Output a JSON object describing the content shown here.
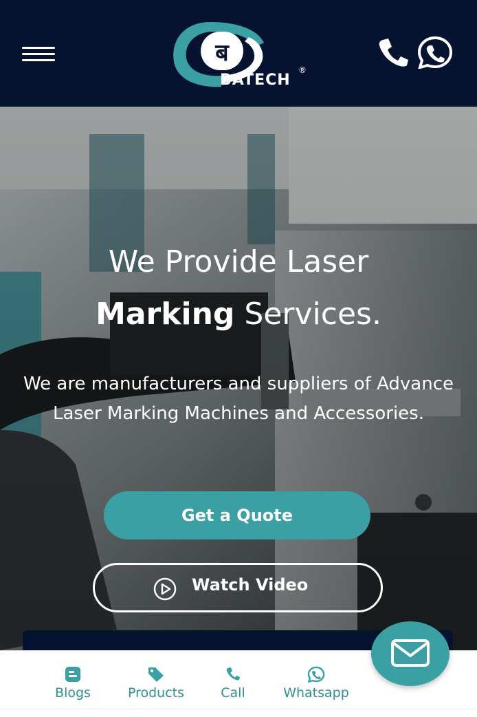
{
  "header": {
    "logo_letter": "ब",
    "logo_text": "BATECH",
    "logo_mark": "®"
  },
  "hero": {
    "title_line1": "We Provide Laser",
    "title_bold": "Marking",
    "title_rest": "Services.",
    "description": "We are manufacturers and suppliers of Advance Laser Marking Machines and Accessories.",
    "quote_label": "Get a Quote",
    "video_label": "Watch Video"
  },
  "bottom_nav": {
    "items": [
      {
        "label": "Blogs",
        "icon": "blog-icon"
      },
      {
        "label": "Products",
        "icon": "tag-icon"
      },
      {
        "label": "Call",
        "icon": "phone-icon"
      },
      {
        "label": "Whatsapp",
        "icon": "whatsapp-icon"
      }
    ]
  },
  "colors": {
    "header_bg": "#061330",
    "accent": "#3aa0a4",
    "nav_text": "#2e8f94"
  }
}
